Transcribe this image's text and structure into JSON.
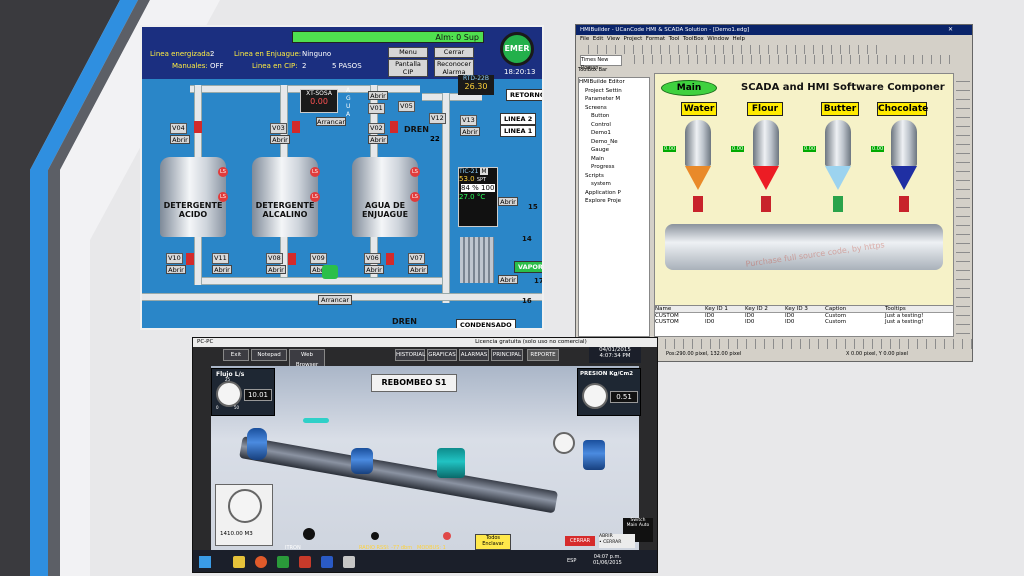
{
  "hmi1": {
    "alarm_text": "Alm: 0 Sup",
    "row1_label": "Linea energizada:",
    "row1_value": "2",
    "row1b_label": "Linea en Enjuague:",
    "row1b_value": "Ninguno",
    "row2_label": "Manuales:",
    "row2_value": "OFF",
    "row2b_label": "Linea en CIP:",
    "row2b_value": "2",
    "row2b_steps": "5 PASOS",
    "btn_menu": "Menu",
    "btn_cerrar": "Cerrar",
    "btn_pantalla": "Pantalla CIP",
    "btn_reconocer": "Reconocer Alarma",
    "emer": "EMER",
    "time": "18:20:13",
    "rtd_label": "RTD-22B",
    "rtd_value": "26.30",
    "retorno": "RETORNO",
    "xt_label": "XT-SOSA",
    "xt_value": "0.00",
    "agua_vertical": "AGUA",
    "linea2": "LINEA 2",
    "linea1": "LINEA 1",
    "dren_top": "DREN",
    "dren_bottom": "DREN",
    "condensado": "CONDENSADO",
    "vapor": "VAPOR",
    "tic_label": "TIC-21",
    "tic_mode": "M",
    "tic_spt": "53.0",
    "tic_spt_unit": "SPT",
    "tic_pct": "84",
    "tic_pct_unit": "%",
    "tic_out": "100",
    "tic_pv": "27.0",
    "tic_pv_unit": "°C",
    "tanks": [
      "DETERGENTE ACIDO",
      "DETERGENTE ALCALINO",
      "AGUA DE ENJUAGUE"
    ],
    "valves": [
      "V04",
      "V03",
      "V01",
      "V02",
      "V05",
      "V12",
      "V13",
      "V10",
      "V11",
      "V08",
      "V09",
      "V06",
      "V07",
      "22"
    ],
    "abrir": "Abrir",
    "arrancar": "Arrancar",
    "ls": "LS",
    "num_15": "15",
    "num_14": "14",
    "num_17": "17",
    "num_16": "16"
  },
  "hmi2": {
    "title": "HMIBuilder - UCanCode HMI & SCADA Solution - [Demo1.edg]",
    "menu": [
      "File",
      "Edit",
      "View",
      "Project",
      "Format",
      "Tool",
      "ToolBox",
      "Window",
      "Help"
    ],
    "font_box": "Times New Roman",
    "tree_header": "ToolBox Bar",
    "tree": [
      "HMIBuilde Editor",
      "Project Settin",
      "Parameter M",
      "Screens",
      "Button",
      "Control",
      "Demo1",
      "Demo_Ne",
      "Gauge",
      "Main",
      "Progress",
      "Scripts",
      "system",
      "Application P",
      "Explore Proje"
    ],
    "main_chip": "Main",
    "canvas_title": "SCADA and HMI Software Componer",
    "silos": [
      "Water",
      "Flour",
      "Butter",
      "Chocolate"
    ],
    "silo_values": [
      "0.00",
      "0.00",
      "0.00",
      "0.00"
    ],
    "watermark": "Purchase full source code, by https",
    "grid_headers": [
      "Name",
      "Key ID 1",
      "Key ID 2",
      "Key ID 3",
      "Caption",
      "Tooltips"
    ],
    "grid_rows": [
      [
        "CUSTOM",
        "ID0",
        "ID0",
        "ID0",
        "Custom",
        "Just a testing!"
      ],
      [
        "CUSTOM",
        "ID0",
        "ID0",
        "ID0",
        "Custom",
        "Just a testing!"
      ]
    ],
    "status_left": "Pos:290.00 pixel, 132.00 pixel",
    "status_right": "X 0.00 pixel, Y 0.00 pixel"
  },
  "hmi3": {
    "window_title": "PC-PC",
    "license": "Licencia gratuita (solo uso no comercial)",
    "toolbar": [
      "Exit",
      "Notepad",
      "Web Browser"
    ],
    "nav": [
      "HISTORIAL",
      "GRAFICAS",
      "ALARMAS",
      "PRINCIPAL"
    ],
    "reporte": "REPORTE",
    "date": "04/01/2015",
    "time": "4:07:34 PM",
    "title": "REBOMBEO S1",
    "flujo_label": "Flujo L/s",
    "flujo_value": "10.01",
    "flujo_scale_min": "0",
    "flujo_scale_mid": "25",
    "flujo_scale_max": "50",
    "presion_label": "PRESION Kg/Cm2",
    "presion_value": "0.51",
    "meter_reading": "1410.00 M3",
    "itron": "ITRON",
    "radio": "RADIO RSSI: -77 dbm",
    "modbus": "MODBUS: 1",
    "todos": "Todos",
    "enclavar": "Enclavar",
    "cerrar_main": "CERRAR",
    "abrir_cerrar": "ABRIR\n• CERRAR",
    "switch_label": "Switch",
    "main_label": "Main",
    "auto_label": "Auto",
    "taskbar_lang": "ESP",
    "taskbar_time": "04:07 p.m.",
    "taskbar_date": "01/06/2015"
  },
  "colors": {
    "slide_bg": "#e8e8ea",
    "stripe_dark": "#3a3a3e",
    "stripe_blue": "#2f8fe0",
    "hmi1_bg": "#2a86c8",
    "hmi1_header": "#1b2f80",
    "alarm_green": "#4fe04f",
    "canvas_yellow": "#f6f2c8"
  }
}
